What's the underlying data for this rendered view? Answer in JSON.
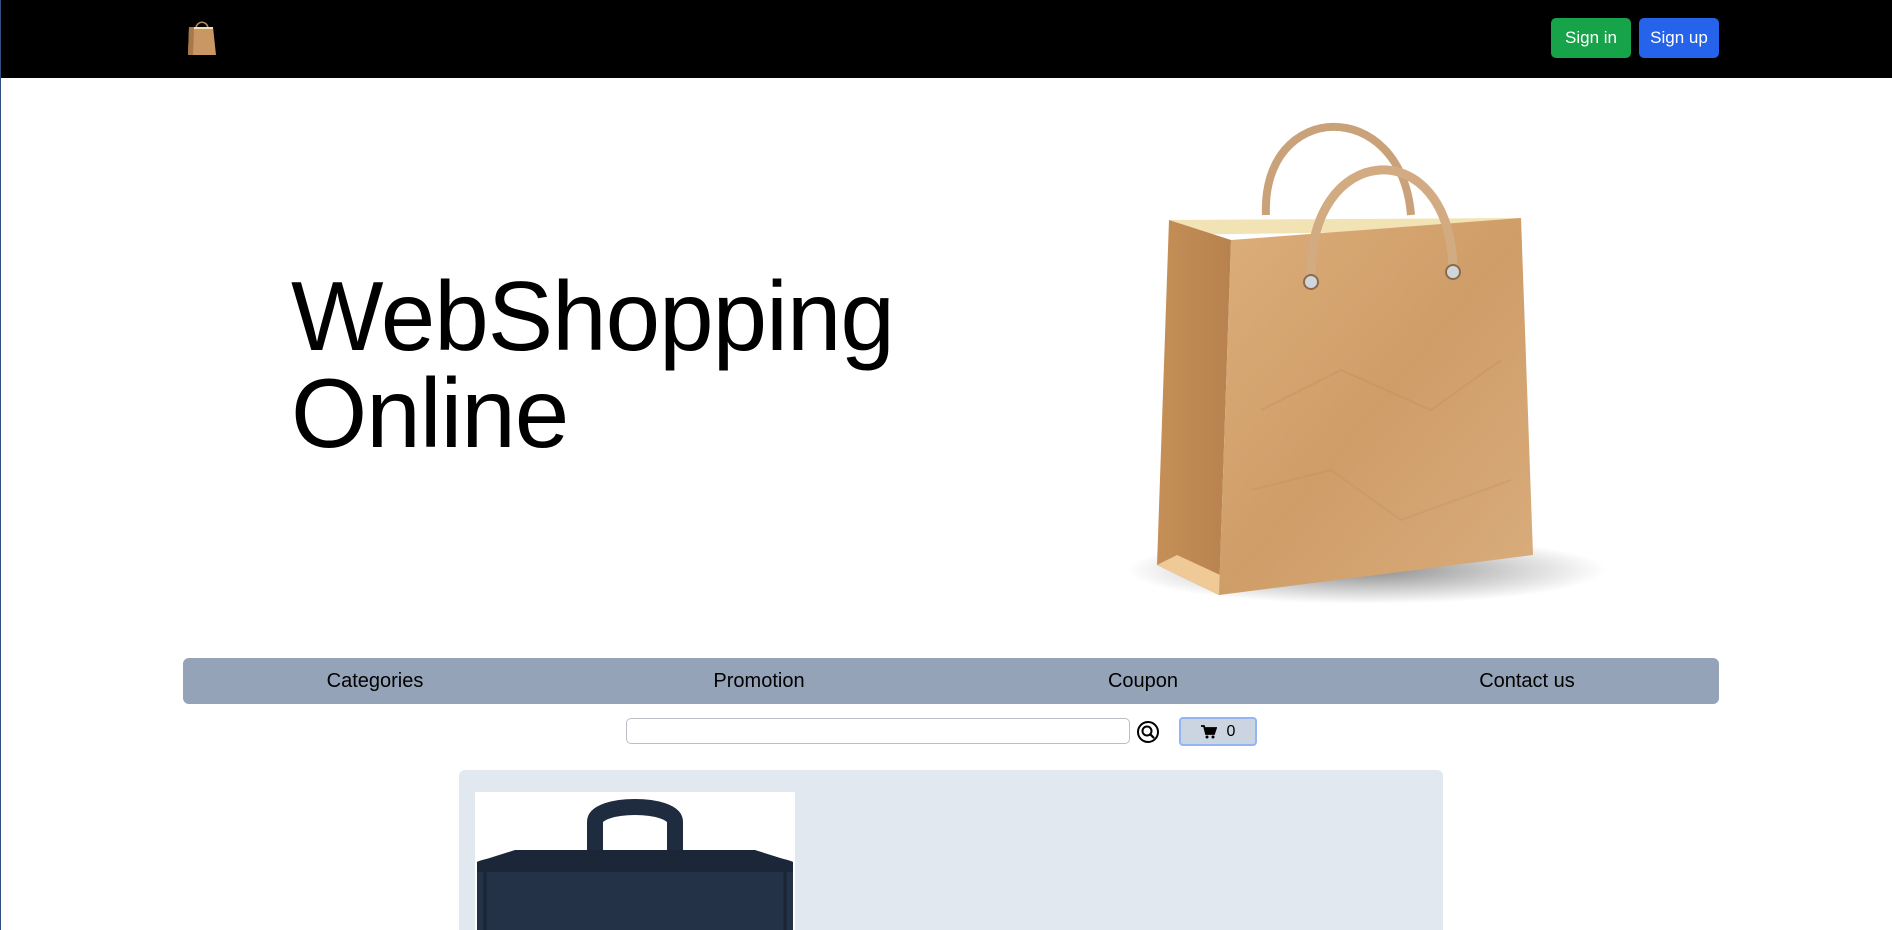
{
  "header": {
    "logo_icon": "shopping-bag-icon",
    "signin_label": "Sign in",
    "signup_label": "Sign up",
    "signin_color": "#17a34a",
    "signup_color": "#2563eb"
  },
  "hero": {
    "title_line1": "WebShopping",
    "title_line2": "Online",
    "image_icon": "shopping-bag-icon"
  },
  "menu": {
    "items": [
      {
        "label": "Categories"
      },
      {
        "label": "Promotion"
      },
      {
        "label": "Coupon"
      },
      {
        "label": "Contact us"
      }
    ],
    "background": "#94a3b8"
  },
  "search": {
    "value": "",
    "placeholder": "",
    "icon": "search-icon"
  },
  "cart": {
    "icon": "cart-icon",
    "count": "0"
  },
  "products": {
    "items": [
      {
        "image_icon": "backpack-icon"
      }
    ]
  }
}
